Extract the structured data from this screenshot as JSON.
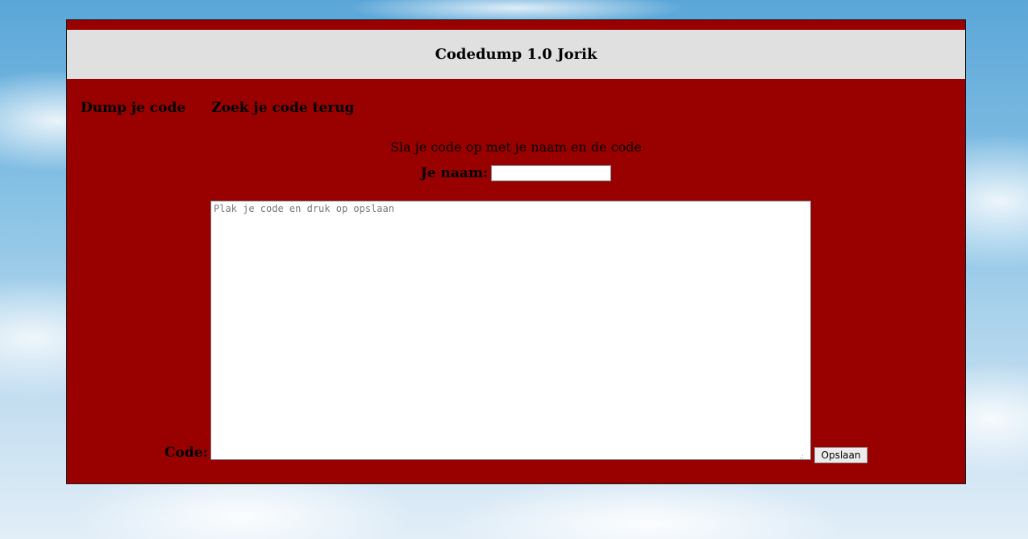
{
  "header": {
    "title": "Codedump 1.0 Jorik"
  },
  "nav": {
    "items": [
      {
        "label": "Dump je code"
      },
      {
        "label": "Zoek je code terug"
      }
    ]
  },
  "form": {
    "intro": "Sla je code op met je naam en de code",
    "name_label": "Je naam:",
    "name_value": "",
    "code_label": "Code:",
    "code_placeholder": "Plak je code en druk op opslaan",
    "save_label": "Opslaan"
  },
  "colors": {
    "panel_background": "#990000",
    "header_background": "#e0e0e0"
  }
}
